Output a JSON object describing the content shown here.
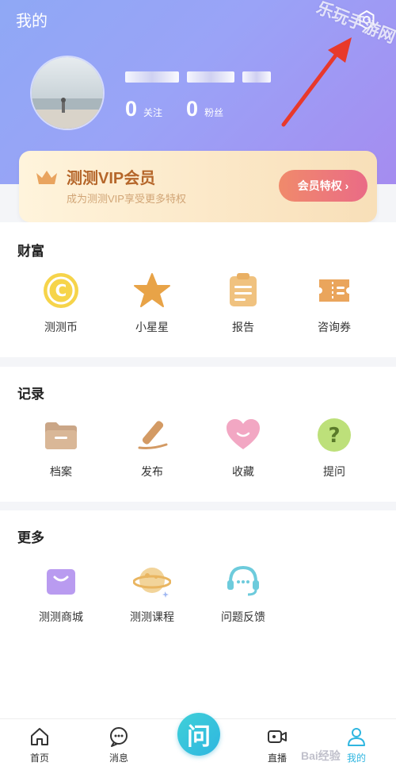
{
  "header": {
    "title": "我的",
    "settings_icon": "gear-icon",
    "watermark": "乐玩手游网",
    "stats": [
      {
        "value": "0",
        "label": "关注"
      },
      {
        "value": "0",
        "label": "粉丝"
      }
    ]
  },
  "vip": {
    "title": "测测VIP会员",
    "subtitle": "成为测测VIP享受更多特权",
    "button": "会员特权 ›"
  },
  "wealth": {
    "title": "财富",
    "items": [
      {
        "label": "测测币",
        "icon": "coin-icon"
      },
      {
        "label": "小星星",
        "icon": "star-icon"
      },
      {
        "label": "报告",
        "icon": "report-icon"
      },
      {
        "label": "咨询券",
        "icon": "ticket-icon"
      }
    ]
  },
  "records": {
    "title": "记录",
    "items": [
      {
        "label": "档案",
        "icon": "folder-icon"
      },
      {
        "label": "发布",
        "icon": "pen-icon"
      },
      {
        "label": "收藏",
        "icon": "heart-icon"
      },
      {
        "label": "提问",
        "icon": "question-icon"
      }
    ]
  },
  "more": {
    "title": "更多",
    "items": [
      {
        "label": "测测商城",
        "icon": "shopping-bag-icon"
      },
      {
        "label": "测测课程",
        "icon": "planet-icon"
      },
      {
        "label": "问题反馈",
        "icon": "headset-icon"
      }
    ]
  },
  "nav": {
    "items": [
      {
        "label": "首页",
        "icon": "home-icon"
      },
      {
        "label": "消息",
        "icon": "message-icon"
      },
      {
        "label": "问",
        "icon": "ask-icon"
      },
      {
        "label": "直播",
        "icon": "camera-icon"
      },
      {
        "label": "我的",
        "icon": "user-icon"
      }
    ]
  },
  "baidu_watermark": "Bai经验",
  "colors": {
    "header_start": "#8fa8f5",
    "header_end": "#a58cf0",
    "vip_text": "#b5662a",
    "vip_button": "#ea6b86",
    "center_button": "#2fb6e0"
  }
}
